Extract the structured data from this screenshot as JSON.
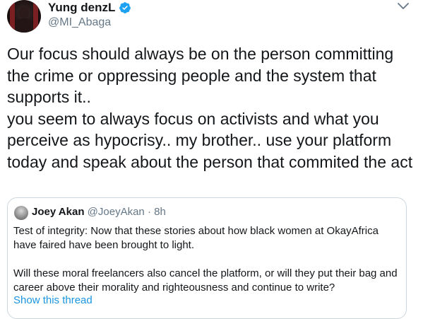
{
  "author": {
    "display_name": "Yung denzL",
    "handle": "@MI_Abaga",
    "verified_icon": "verified-badge-icon",
    "verified_color": "#1da1f2"
  },
  "tweet": {
    "text": "Our focus should always be on the person committing the crime or oppressing people and the system that supports it..\nyou seem to always focus on activists and what you perceive as hypocrisy.. my brother.. use your platform today and speak about the person that commited the act"
  },
  "quoted_tweet": {
    "display_name": "Joey Akan",
    "handle": "@JoeyAkan",
    "time": "· 8h",
    "paragraph_1": "Test of integrity: Now that these stories about how black women at OkayAfrica have faired have been brought to light.",
    "paragraph_2": "Will these moral freelancers also cancel the platform, or will they put their bag and career above their morality and righteousness and continue to write?",
    "show_thread_label": "Show this thread",
    "link_color": "#1b95e0",
    "border_color": "#ccd6dd"
  },
  "menu_icon": "chevron-down-icon"
}
